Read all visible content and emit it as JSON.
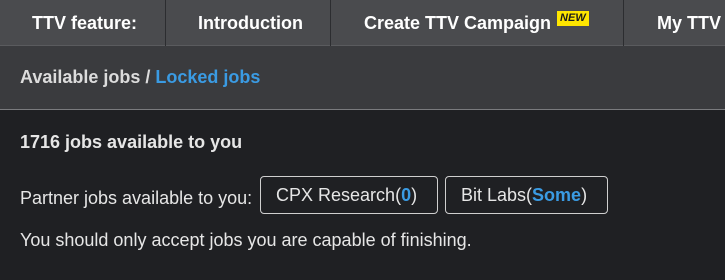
{
  "nav": {
    "feature_label": "TTV feature:",
    "introduction_label": "Introduction",
    "create_campaign_label": "Create TTV Campaign",
    "new_badge": "NEW",
    "my_ttv_label": "My TTV"
  },
  "breadcrumb": {
    "current": "Available jobs",
    "separator": "/",
    "link": "Locked jobs"
  },
  "main": {
    "jobs_count_text": "1716 jobs available to you",
    "partner_label": "Partner jobs available to you:",
    "partners": [
      {
        "name": "CPX Research",
        "open": " (",
        "count": "0",
        "close": ")"
      },
      {
        "name": "Bit Labs",
        "open": " (",
        "count": "Some",
        "close": ")"
      }
    ],
    "notice": "You should only accept jobs you are capable of finishing."
  },
  "colors": {
    "nav_bg": "#4a4b4e",
    "breadcrumb_bg": "#3a3b3e",
    "page_bg": "#1f2023",
    "link_accent": "#3a9be3",
    "badge_bg": "#ffe600"
  }
}
